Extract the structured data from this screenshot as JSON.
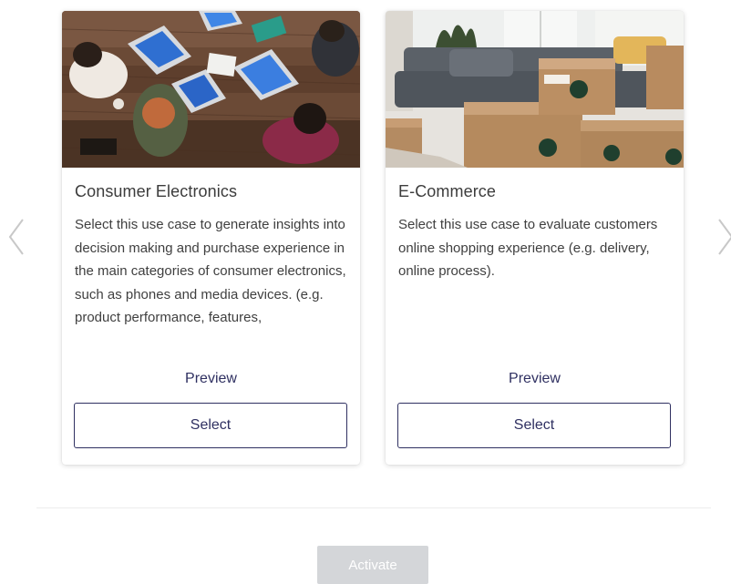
{
  "carousel": {
    "prev_icon": "chevron-left-icon",
    "next_icon": "chevron-right-icon"
  },
  "cards": [
    {
      "image": "office-team-laptops-photo",
      "title": "Consumer Electronics",
      "description": "Select this use case to generate insights into decision making and purchase experience in the main categories of consumer electronics, such as phones and media devices. (e.g. product performance, features,",
      "preview_label": "Preview",
      "select_label": "Select"
    },
    {
      "image": "delivery-boxes-living-room-photo",
      "title": "E-Commerce",
      "description": "Select this use case to evaluate customers online shopping experience (e.g. delivery, online process).",
      "preview_label": "Preview",
      "select_label": "Select"
    }
  ],
  "footer": {
    "activate_label": "Activate",
    "activate_enabled": false
  },
  "colors": {
    "accent": "#2f3061",
    "disabled_button": "#d4d6d9",
    "arrow": "#c8c8c8"
  }
}
